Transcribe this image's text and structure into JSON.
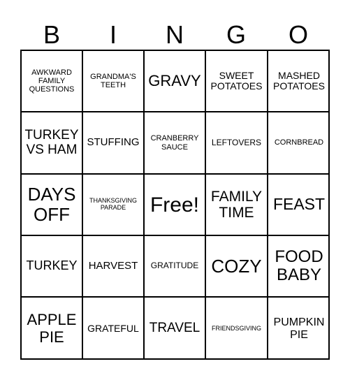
{
  "header": [
    "B",
    "I",
    "N",
    "G",
    "O"
  ],
  "cells": [
    [
      "AWKWARD FAMILY QUESTIONS",
      "GRANDMA'S TEETH",
      "GRAVY",
      "SWEET POTATOES",
      "MASHED POTATOES"
    ],
    [
      "TURKEY VS HAM",
      "STUFFING",
      "CRANBERRY SAUCE",
      "LEFTOVERS",
      "CORNBREAD"
    ],
    [
      "DAYS OFF",
      "THANKSGIVING PARADE",
      "Free!",
      "FAMILY TIME",
      "FEAST"
    ],
    [
      "TURKEY",
      "HARVEST",
      "GRATITUDE",
      "COZY",
      "FOOD BABY"
    ],
    [
      "APPLE PIE",
      "GRATEFUL",
      "TRAVEL",
      "FRIENDSGIVING",
      "PUMPKIN PIE"
    ]
  ]
}
